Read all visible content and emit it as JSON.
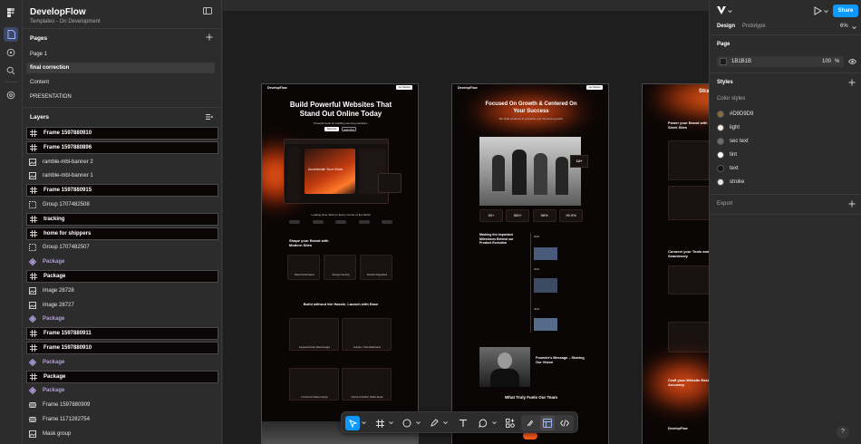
{
  "file": {
    "title": "DevelopFlow",
    "subtitle": "Templates - On Development"
  },
  "pages": {
    "heading": "Pages",
    "items": [
      {
        "label": "Page 1",
        "selected": false
      },
      {
        "label": "final correction",
        "selected": true
      },
      {
        "label": "Content",
        "selected": false
      },
      {
        "label": "PRESENTATION",
        "selected": false
      }
    ]
  },
  "layers": {
    "heading": "Layers",
    "items": [
      {
        "label": "Frame 1597880910",
        "kind": "frame"
      },
      {
        "label": "Frame 1597880896",
        "kind": "frame"
      },
      {
        "label": "ramble-mbl-banner 2",
        "kind": "image"
      },
      {
        "label": "ramble-mbl-banner 1",
        "kind": "image"
      },
      {
        "label": "Frame 1597880915",
        "kind": "frame"
      },
      {
        "label": "Group 1707482508",
        "kind": "group"
      },
      {
        "label": "tracking",
        "kind": "frame"
      },
      {
        "label": "home for shippers",
        "kind": "frame"
      },
      {
        "label": "Group 1707482507",
        "kind": "group"
      },
      {
        "label": "Package",
        "kind": "component"
      },
      {
        "label": "Package",
        "kind": "frame"
      },
      {
        "label": "image 28728",
        "kind": "image"
      },
      {
        "label": "image 28727",
        "kind": "image"
      },
      {
        "label": "Package",
        "kind": "component"
      },
      {
        "label": "Frame 1597880911",
        "kind": "frame"
      },
      {
        "label": "Frame 1597880910",
        "kind": "frame"
      },
      {
        "label": "Package",
        "kind": "component"
      },
      {
        "label": "Package",
        "kind": "frame"
      },
      {
        "label": "Package",
        "kind": "component"
      },
      {
        "label": "Frame 1597880909",
        "kind": "autolayout"
      },
      {
        "label": "Frame 1171282754",
        "kind": "autolayout"
      },
      {
        "label": "Mask group",
        "kind": "image"
      }
    ]
  },
  "canvas": {
    "frame1": {
      "brand": "DevelopFlow",
      "cta": "Get Started",
      "hero_title": "Build Powerful Websites That Stand Out Online Today",
      "hero_sub": "Powerful tools for building stunning websites.",
      "btn_primary": "Start Now",
      "btn_secondary": "Learn More",
      "app_title": "Accelerate Your Work",
      "caption": "Loading Now, Start on Every Corner of the World",
      "section2_title": "Shape your Brand with Modern Sites",
      "feature1": "Better Performance",
      "feature2": "Stronger Security",
      "feature3": "Smooth Integrations",
      "section3_title": "Build without the Hassle, Launch with Ease",
      "card1": "Integrated Ready Made Designs",
      "card2": "Analytics, Tools Dashboards",
      "card3": "AI Tools For Modern Design",
      "card4": "Optimized Publish, Mobile Ready"
    },
    "frame2": {
      "brand": "DevelopFlow",
      "cta": "Get Started",
      "hero_title": "Focused On Growth & Centered On Your Success",
      "hero_sub": "We build solutions to empower your business growth.",
      "badge": "12+",
      "stats": [
        "50+",
        "500+",
        "98%",
        "99.9%"
      ],
      "milestone_title": "Marking the Important Milestones Behind our Product Evolution",
      "years": [
        "2020",
        "2021",
        "2022",
        "2023"
      ],
      "founder_title": "Founder's Message – Sharing Our Vision",
      "team_title": "What Truly Fuels Our Team"
    },
    "frame3": {
      "hero_title": "Strategies Ideas",
      "title_a": "Power your Brand with Sleek Sites",
      "title_b": "Connect your Tools and Work Seamlessly",
      "title_c": "Craft your Website Easily with Accuracy",
      "brand": "DevelopFlow"
    }
  },
  "right_panel": {
    "tabs": [
      "Design",
      "Prototype"
    ],
    "zoom": "6%",
    "share_label": "Share",
    "page_heading": "Page",
    "page_color": "1B1B1B",
    "page_opacity": "100",
    "page_opacity_unit": "%",
    "styles_heading": "Styles",
    "color_styles_heading": "Color styles",
    "color_styles": [
      {
        "name": "#D9D9D9",
        "color": "#8a6a3a"
      },
      {
        "name": "light",
        "color": "#f5ede4"
      },
      {
        "name": "sec text",
        "color": "#6b6b6b"
      },
      {
        "name": "tint",
        "color": "#ffffff"
      },
      {
        "name": "text",
        "color": "#141414"
      },
      {
        "name": "stroke",
        "color": "#e8e8e8"
      }
    ],
    "export_heading": "Export",
    "help": "?"
  },
  "colors": {
    "accent": "#0d99ff",
    "brand_orange": "#ff5a1f",
    "canvas_bg": "#1e1e1e"
  }
}
